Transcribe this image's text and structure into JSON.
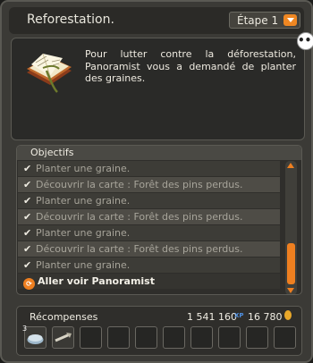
{
  "header": {
    "title": "Reforestation.",
    "step_label": "Étape 1"
  },
  "description": {
    "text": "Pour lutter contre la déforestation, Panoramist vous a demandé de planter des graines.",
    "more_label": "•••"
  },
  "objectives": {
    "title": "Objectifs",
    "done_mark": "✔",
    "items": [
      "Planter une graine.",
      "Découvrir la carte : Forêt des pins perdus.",
      "Planter une graine.",
      "Découvrir la carte : Forêt des pins perdus.",
      "Planter une graine.",
      "Découvrir la carte : Forêt des pins perdus.",
      "Planter une graine."
    ],
    "current": "Aller voir Panoramist",
    "scroll_position": 0.72
  },
  "rewards": {
    "title": "Récompenses",
    "xp": "1 541 160",
    "xp_icon": "XP",
    "kamas": "16 780",
    "kamas_icon": "K",
    "items": [
      {
        "qty": "3"
      }
    ]
  }
}
